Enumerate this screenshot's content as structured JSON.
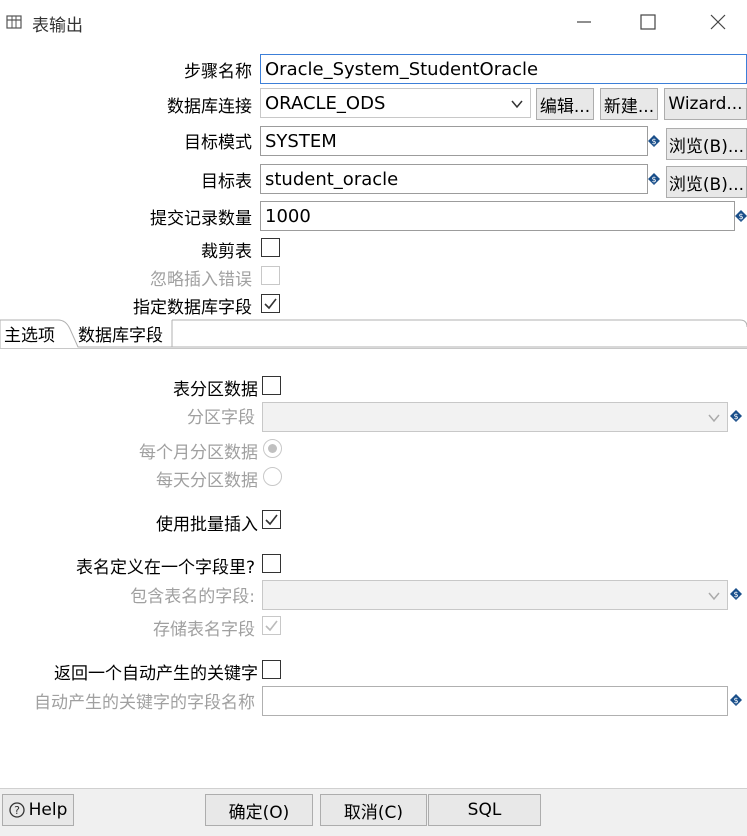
{
  "window": {
    "title": "表输出",
    "icons": {
      "app": "table-icon",
      "minimize": "minimize-icon",
      "maximize": "maximize-icon",
      "close": "close-icon"
    }
  },
  "form": {
    "step_name_label": "步骤名称",
    "step_name_value": "Oracle_System_StudentOracle",
    "connection_label": "数据库连接",
    "connection_value": "ORACLE_ODS",
    "edit_button": "编辑...",
    "new_button": "新建...",
    "wizard_button": "Wizard...",
    "schema_label": "目标模式",
    "schema_value": "SYSTEM",
    "schema_browse_button": "浏览(B)...",
    "table_label": "目标表",
    "table_value": "student_oracle",
    "table_browse_button": "浏览(B)...",
    "commit_size_label": "提交记录数量",
    "commit_size_value": "1000",
    "truncate_label": "裁剪表",
    "truncate_checked": false,
    "ignore_errors_label": "忽略插入错误",
    "ignore_errors_checked": false,
    "specify_fields_label": "指定数据库字段",
    "specify_fields_checked": true
  },
  "tabs": [
    {
      "label": "主选项",
      "active": true
    },
    {
      "label": "数据库字段",
      "active": false
    }
  ],
  "main_options": {
    "partition_label": "表分区数据",
    "partition_checked": false,
    "partition_field_label": "分区字段",
    "partition_field_value": "",
    "monthly_label": "每个月分区数据",
    "monthly_selected": true,
    "daily_label": "每天分区数据",
    "daily_selected": false,
    "batch_label": "使用批量插入",
    "batch_checked": true,
    "tablename_in_field_label": "表名定义在一个字段里?",
    "tablename_in_field_checked": false,
    "tablename_field_label": "包含表名的字段:",
    "tablename_field_value": "",
    "store_tablename_label": "存储表名字段",
    "store_tablename_checked": true,
    "return_key_label": "返回一个自动产生的关键字",
    "return_key_checked": false,
    "key_field_label": "自动产生的关键字的字段名称",
    "key_field_value": ""
  },
  "footer": {
    "help_button": "Help",
    "ok_button": "确定(O)",
    "cancel_button": "取消(C)",
    "sql_button": "SQL"
  },
  "colors": {
    "focus_border": "#3c7fd8",
    "disabled_text": "#a0a0a0",
    "variable_icon": "#1a4f8a"
  }
}
